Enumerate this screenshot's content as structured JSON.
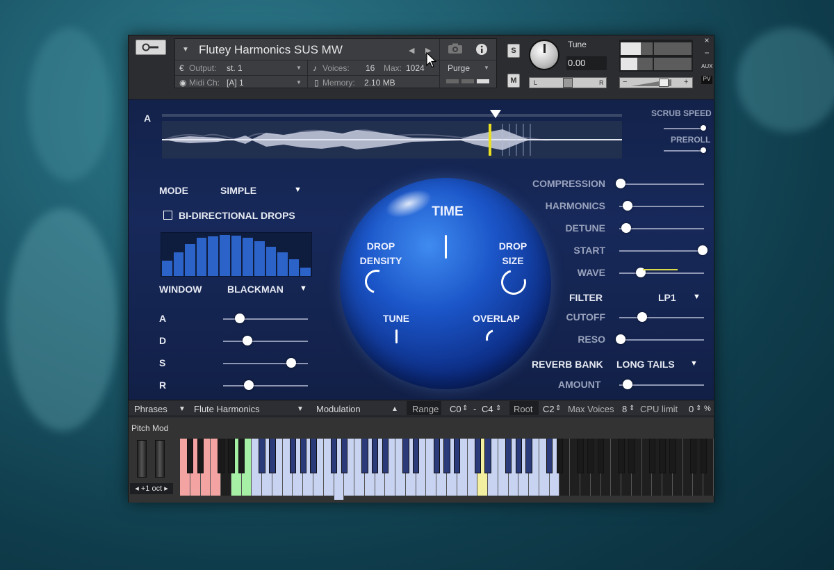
{
  "header": {
    "instrument_name": "Flutey Harmonics SUS MW",
    "output_label": "Output:",
    "output_value": "st. 1",
    "voices_label": "Voices:",
    "voices_value": "16",
    "max_label": "Max:",
    "max_value": "1024",
    "midi_label": "Midi Ch:",
    "midi_value": "[A] 1",
    "memory_label": "Memory:",
    "memory_value": "2.10 MB",
    "purge_label": "Purge",
    "solo_label": "S",
    "mute_label": "M",
    "tune_label": "Tune",
    "tune_value": "0.00",
    "pan_left": "L",
    "pan_right": "R",
    "aux_label": "AUX",
    "pv_label": "PV",
    "close_label": "×",
    "min_label": "−",
    "vol_minus": "−",
    "vol_plus": "+"
  },
  "waveform": {
    "slot_label": "A",
    "scrub_speed_label": "SCRUB SPEED",
    "preroll_label": "PREROLL",
    "scrub_speed_value": 0.95,
    "preroll_value": 0.95,
    "playhead_position": 0.72
  },
  "left": {
    "mode_label": "MODE",
    "mode_value": "SIMPLE",
    "bidirectional_label": "BI-DIRECTIONAL DROPS",
    "bidirectional_checked": false,
    "window_label": "WINDOW",
    "window_value": "BLACKMAN",
    "window_bars": [
      0.35,
      0.55,
      0.75,
      0.88,
      0.92,
      0.95,
      0.93,
      0.88,
      0.8,
      0.68,
      0.55,
      0.38,
      0.2
    ],
    "adsr": [
      {
        "label": "A",
        "value": 0.2
      },
      {
        "label": "D",
        "value": 0.29
      },
      {
        "label": "S",
        "value": 0.8
      },
      {
        "label": "R",
        "value": 0.3
      }
    ]
  },
  "orb": {
    "time_label": "TIME",
    "drop_density_label": "DROP\nDENSITY",
    "drop_size_label": "DROP\nSIZE",
    "tune_label": "TUNE",
    "overlap_label": "OVERLAP"
  },
  "right": {
    "sliders_top": [
      {
        "label": "COMPRESSION",
        "value": 0.02
      },
      {
        "label": "HARMONICS",
        "value": 0.1
      },
      {
        "label": "DETUNE",
        "value": 0.08
      },
      {
        "label": "START",
        "value": 0.98
      },
      {
        "label": "WAVE",
        "value": 0.25
      }
    ],
    "filter_label": "FILTER",
    "filter_value": "LP1",
    "sliders_filter": [
      {
        "label": "CUTOFF",
        "value": 0.27
      },
      {
        "label": "RESO",
        "value": 0.02
      }
    ],
    "reverb_label": "REVERB BANK",
    "reverb_value": "LONG TAILS",
    "amount_label": "AMOUNT",
    "amount_value": 0.1
  },
  "bottom_bar": {
    "phrases_label": "Phrases",
    "phrase_value": "Flute Harmonics",
    "modulation_label": "Modulation",
    "range_label": "Range",
    "range_low": "C0",
    "range_sep": "-",
    "range_high": "C4",
    "root_label": "Root",
    "root_value": "C2",
    "max_voices_label": "Max Voices",
    "max_voices_value": "8",
    "cpu_label": "CPU limit",
    "cpu_value": "0",
    "cpu_unit": "%"
  },
  "keyboard": {
    "pitch_mod_label": "Pitch Mod",
    "octave_label": "+1 oct",
    "colors": {
      "red": "#f4a3a3",
      "green": "#a6f0a6",
      "blue": "#c8d3f2",
      "blue_black": "#2b3a78",
      "yellow": "#f2f0a0",
      "white": "#f0f0f0",
      "black": "#1a1a1a",
      "dark_white": "#1f1f1f"
    }
  },
  "colors": {
    "accent": "#ffffff",
    "panel_bg": "#17295a",
    "orb_blue": "#1b55c8"
  }
}
